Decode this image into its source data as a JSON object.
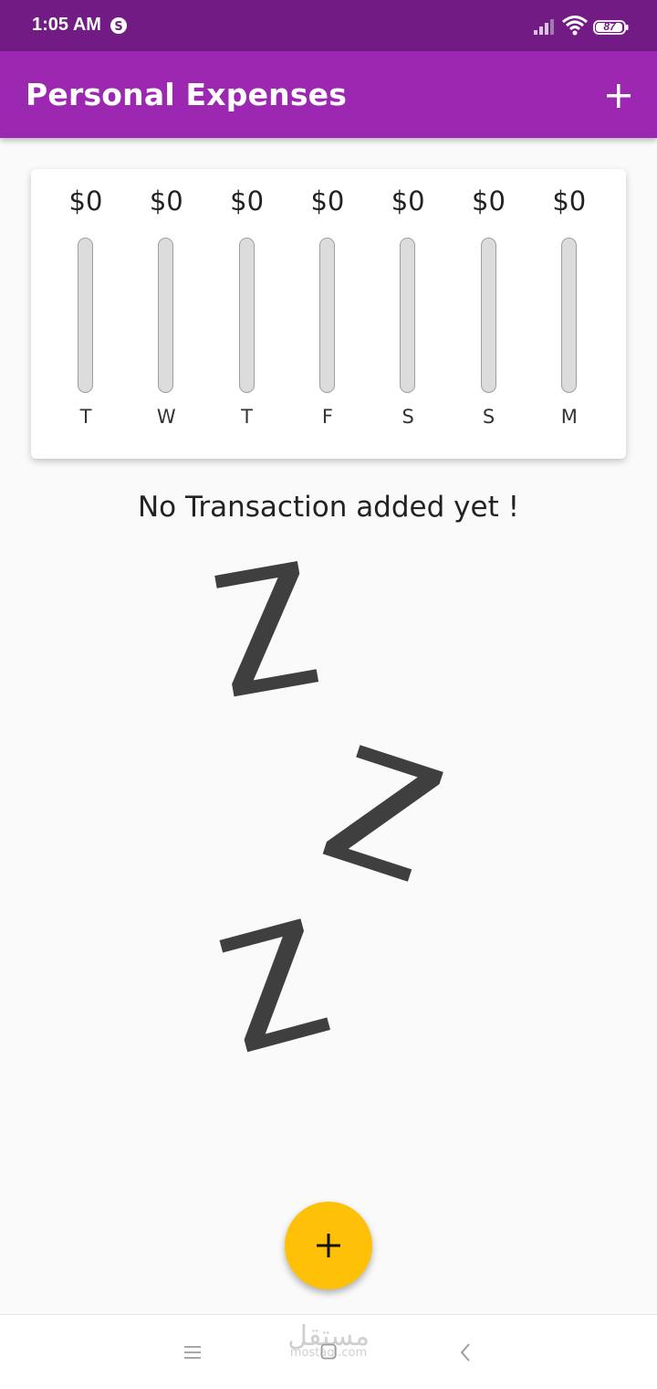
{
  "status_bar": {
    "time": "1:05 AM",
    "battery": "87"
  },
  "app_bar": {
    "title": "Personal Expenses"
  },
  "chart": {
    "bars": [
      {
        "day": "T",
        "amount": "$0",
        "fraction": 0
      },
      {
        "day": "W",
        "amount": "$0",
        "fraction": 0
      },
      {
        "day": "T",
        "amount": "$0",
        "fraction": 0
      },
      {
        "day": "F",
        "amount": "$0",
        "fraction": 0
      },
      {
        "day": "S",
        "amount": "$0",
        "fraction": 0
      },
      {
        "day": "S",
        "amount": "$0",
        "fraction": 0
      },
      {
        "day": "M",
        "amount": "$0",
        "fraction": 0
      }
    ]
  },
  "empty_state": {
    "message": "No Transaction added yet !"
  },
  "watermark": {
    "arabic": "مستقل",
    "latin": "mostaql.com"
  },
  "colors": {
    "status_bar": "#721b84",
    "app_bar": "#9c27b0",
    "fab": "#ffc107",
    "bar_track": "#dcdcdc"
  },
  "icons": {
    "add_action": "plus-icon",
    "fab": "plus-icon",
    "nav_menu": "menu-icon",
    "nav_home": "home-square-icon",
    "nav_back": "back-chevron-icon"
  }
}
